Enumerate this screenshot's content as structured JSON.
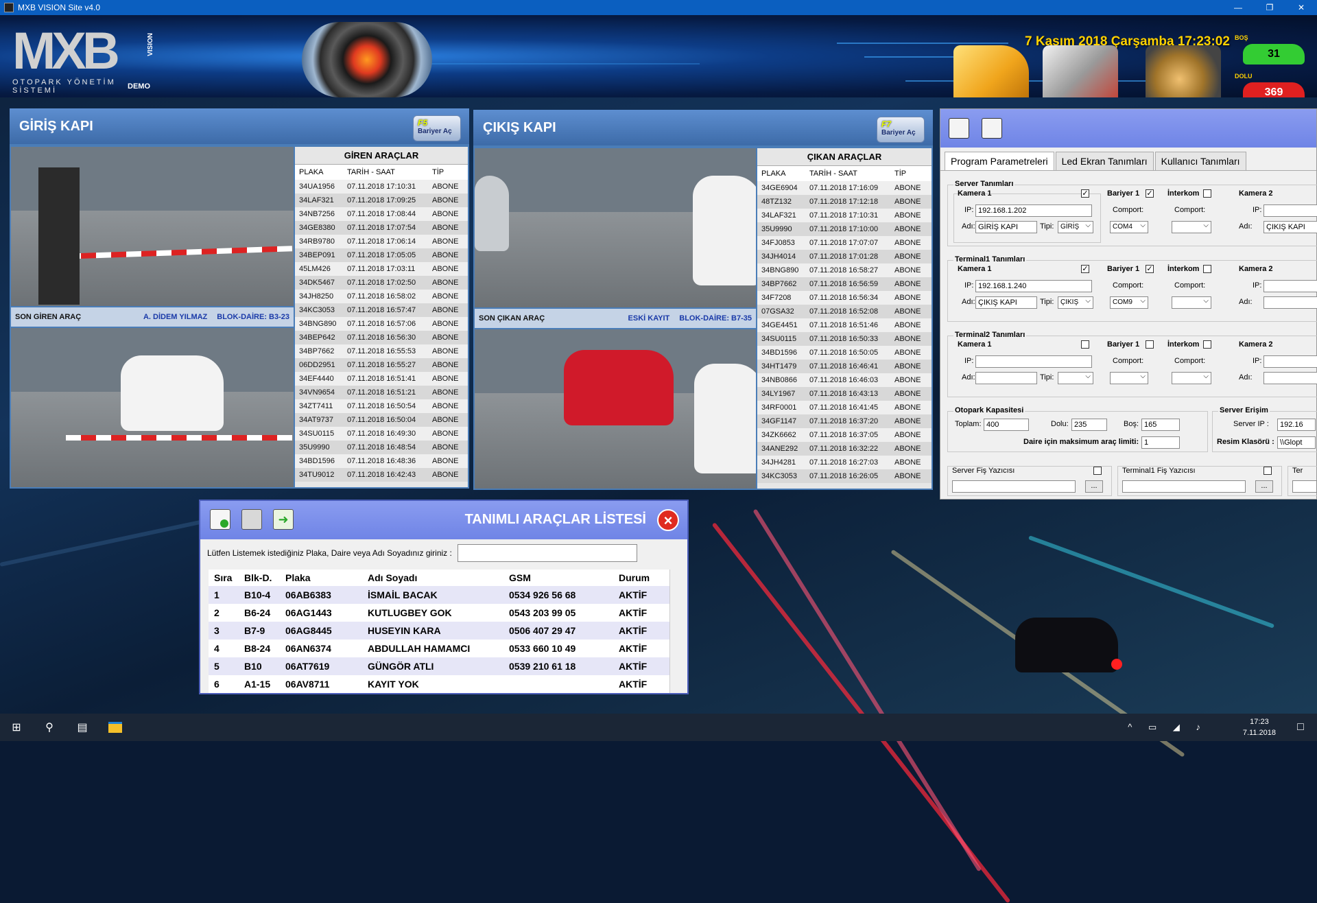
{
  "window": {
    "title": "MXB VISION Site v4.0"
  },
  "header": {
    "logo_text": "MXB",
    "logo_vertical": "VISION",
    "logo_subtitle": "OTOPARK YÖNETİM SİSTEMİ",
    "logo_demo": "DEMO",
    "datetime": "7 Kasım 2018 Çarşamba 17:23:02",
    "empty_tag": "BOŞ",
    "empty_count": "31",
    "full_tag": "DOLU",
    "full_count": "369"
  },
  "entry": {
    "title": "GİRİŞ KAPI",
    "barrier_key": "F5",
    "barrier_label": "Bariyer Aç",
    "last_label": "SON GİREN ARAÇ",
    "last_name": "A. DİDEM YILMAZ",
    "last_block": "BLOK-DAİRE: B3-23",
    "list_title": "GİREN ARAÇLAR",
    "columns": [
      "PLAKA",
      "TARİH - SAAT",
      "TİP"
    ],
    "rows": [
      [
        "34UA1956",
        "07.11.2018 17:10:31",
        "ABONE"
      ],
      [
        "34LAF321",
        "07.11.2018 17:09:25",
        "ABONE"
      ],
      [
        "34NB7256",
        "07.11.2018 17:08:44",
        "ABONE"
      ],
      [
        "34GE8380",
        "07.11.2018 17:07:54",
        "ABONE"
      ],
      [
        "34RB9780",
        "07.11.2018 17:06:14",
        "ABONE"
      ],
      [
        "34BEP091",
        "07.11.2018 17:05:05",
        "ABONE"
      ],
      [
        "45LM426",
        "07.11.2018 17:03:11",
        "ABONE"
      ],
      [
        "34DK5467",
        "07.11.2018 17:02:50",
        "ABONE"
      ],
      [
        "34JH8250",
        "07.11.2018 16:58:02",
        "ABONE"
      ],
      [
        "34KC3053",
        "07.11.2018 16:57:47",
        "ABONE"
      ],
      [
        "34BNG890",
        "07.11.2018 16:57:06",
        "ABONE"
      ],
      [
        "34BEP642",
        "07.11.2018 16:56:30",
        "ABONE"
      ],
      [
        "34BP7662",
        "07.11.2018 16:55:53",
        "ABONE"
      ],
      [
        "06DD2951",
        "07.11.2018 16:55:27",
        "ABONE"
      ],
      [
        "34EF4440",
        "07.11.2018 16:51:41",
        "ABONE"
      ],
      [
        "34VN9654",
        "07.11.2018 16:51:21",
        "ABONE"
      ],
      [
        "34ZT7411",
        "07.11.2018 16:50:54",
        "ABONE"
      ],
      [
        "34AT9737",
        "07.11.2018 16:50:04",
        "ABONE"
      ],
      [
        "34SU0115",
        "07.11.2018 16:49:30",
        "ABONE"
      ],
      [
        "35U9990",
        "07.11.2018 16:48:54",
        "ABONE"
      ],
      [
        "34BD1596",
        "07.11.2018 16:48:36",
        "ABONE"
      ],
      [
        "34TU9012",
        "07.11.2018 16:42:43",
        "ABONE"
      ]
    ]
  },
  "exit": {
    "title": "ÇIKIŞ KAPI",
    "barrier_key": "F7",
    "barrier_label": "Bariyer Aç",
    "last_label": "SON ÇIKAN ARAÇ",
    "last_name": "ESKİ KAYIT",
    "last_block": "BLOK-DAİRE: B7-35",
    "list_title": "ÇIKAN ARAÇLAR",
    "columns": [
      "PLAKA",
      "TARİH - SAAT",
      "TİP"
    ],
    "rows": [
      [
        "34GE6904",
        "07.11.2018 17:16:09",
        "ABONE"
      ],
      [
        "48TZ132",
        "07.11.2018 17:12:18",
        "ABONE"
      ],
      [
        "34LAF321",
        "07.11.2018 17:10:31",
        "ABONE"
      ],
      [
        "35U9990",
        "07.11.2018 17:10:00",
        "ABONE"
      ],
      [
        "34FJ0853",
        "07.11.2018 17:07:07",
        "ABONE"
      ],
      [
        "34JH4014",
        "07.11.2018 17:01:28",
        "ABONE"
      ],
      [
        "34BNG890",
        "07.11.2018 16:58:27",
        "ABONE"
      ],
      [
        "34BP7662",
        "07.11.2018 16:56:59",
        "ABONE"
      ],
      [
        "34F7208",
        "07.11.2018 16:56:34",
        "ABONE"
      ],
      [
        "07GSA32",
        "07.11.2018 16:52:08",
        "ABONE"
      ],
      [
        "34GE4451",
        "07.11.2018 16:51:46",
        "ABONE"
      ],
      [
        "34SU0115",
        "07.11.2018 16:50:33",
        "ABONE"
      ],
      [
        "34BD1596",
        "07.11.2018 16:50:05",
        "ABONE"
      ],
      [
        "34HT1479",
        "07.11.2018 16:46:41",
        "ABONE"
      ],
      [
        "34NB0866",
        "07.11.2018 16:46:03",
        "ABONE"
      ],
      [
        "34LY1967",
        "07.11.2018 16:43:13",
        "ABONE"
      ],
      [
        "34RF0001",
        "07.11.2018 16:41:45",
        "ABONE"
      ],
      [
        "34GF1147",
        "07.11.2018 16:37:20",
        "ABONE"
      ],
      [
        "34ZK6662",
        "07.11.2018 16:37:05",
        "ABONE"
      ],
      [
        "34ANE292",
        "07.11.2018 16:32:22",
        "ABONE"
      ],
      [
        "34JH4281",
        "07.11.2018 16:27:03",
        "ABONE"
      ],
      [
        "34KC3053",
        "07.11.2018 16:26:05",
        "ABONE"
      ]
    ]
  },
  "settings": {
    "tabs": [
      "Program Parametreleri",
      "Led Ekran Tanımları",
      "Kullanıcı Tanımları"
    ],
    "server_legend": "Server Tanımları",
    "terminal1_legend": "Terminal1 Tanımları",
    "terminal2_legend": "Terminal2 Tanımları",
    "camera1": "Kamera 1",
    "camera2": "Kamera 2",
    "barrier1": "Bariyer 1",
    "intercom": "İnterkom",
    "ip_label": "IP:",
    "name_label": "Adı:",
    "type_label": "Tipi:",
    "comport_label": "Comport:",
    "server_ip": "192.168.1.202",
    "server_name": "GİRİŞ KAPI",
    "server_type": "GİRİŞ",
    "server_com": "COM4",
    "server_cam2_name": "ÇIKIŞ KAPI",
    "t1_ip": "192.168.1.240",
    "t1_name": "ÇIKIŞ KAPI",
    "t1_type": "ÇIKIŞ",
    "t1_com": "COM9",
    "capacity_legend": "Otopark Kapasitesi",
    "total_label": "Toplam:",
    "total_value": "400",
    "full_label": "Dolu:",
    "full_value": "235",
    "empty_label": "Boş:",
    "empty_value": "165",
    "max_label": "Daire için maksimum araç limiti:",
    "max_value": "1",
    "server_access_legend": "Server Erişim",
    "server_ip_label": "Server IP :",
    "server_ip_value": "192.16",
    "image_folder_label": "Resim Klasörü :",
    "image_folder_value": "\\\\Glopt",
    "server_printer": "Server Fiş Yazıcısı",
    "t1_printer": "Terminal1 Fiş Yazıcısı",
    "t2_printer_partial": "Ter",
    "dots": "..."
  },
  "reglist": {
    "title": "TANIMLI ARAÇLAR LİSTESİ",
    "search_label": "Lütfen Listemek istediğiniz Plaka, Daire veya Adı Soyadınız giriniz :",
    "search_value": "",
    "columns": [
      "Sıra",
      "Blk-D.",
      "Plaka",
      "Adı Soyadı",
      "GSM",
      "Durum"
    ],
    "rows": [
      [
        "1",
        "B10-4",
        "06AB6383",
        "İSMAİL BACAK",
        "0534 926 56 68",
        "AKTİF"
      ],
      [
        "2",
        "B6-24",
        "06AG1443",
        "KUTLUGBEY GOK",
        "0543 203 99 05",
        "AKTİF"
      ],
      [
        "3",
        "B7-9",
        "06AG8445",
        "HUSEYIN KARA",
        "0506 407 29 47",
        "AKTİF"
      ],
      [
        "4",
        "B8-24",
        "06AN6374",
        "ABDULLAH HAMAMCI",
        "0533 660 10 49",
        "AKTİF"
      ],
      [
        "5",
        "B10",
        "06AT7619",
        "GÜNGÖR ATLI",
        "0539 210 61 18",
        "AKTİF"
      ],
      [
        "6",
        "A1-15",
        "06AV8711",
        "KAYIT YOK",
        "",
        "AKTİF"
      ]
    ]
  },
  "taskbar": {
    "time": "17:23",
    "date": "7.11.2018"
  },
  "colors": {
    "accent": "#6f84e6",
    "panel": "#4a7db8",
    "datetime": "#ffd200",
    "empty": "#33cc33",
    "full": "#e02020"
  }
}
